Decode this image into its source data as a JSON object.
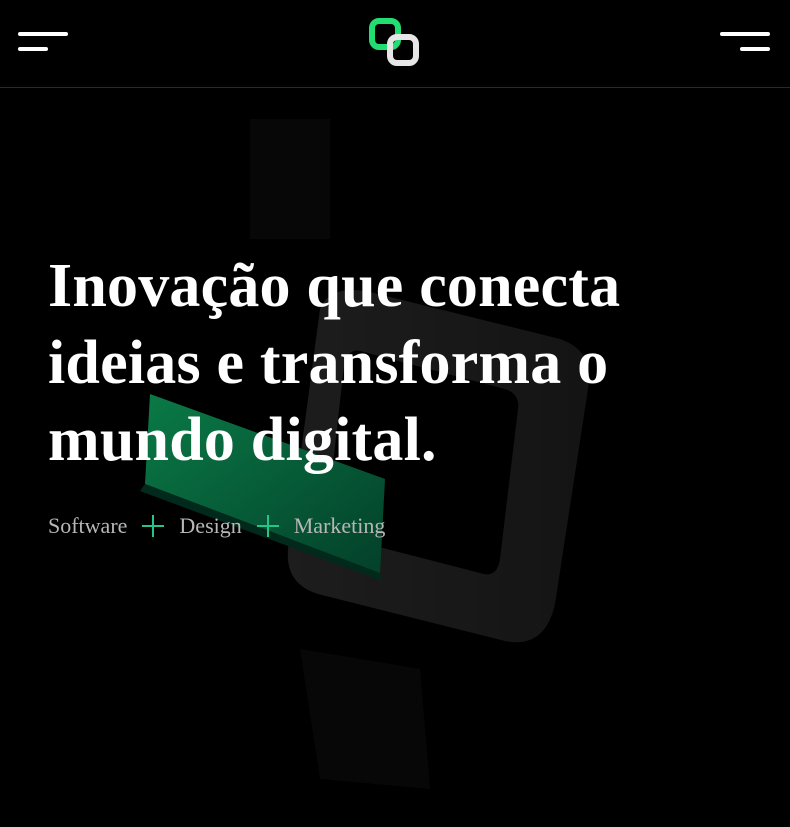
{
  "header": {
    "menu_left_icon": "menu-icon",
    "menu_right_icon": "menu-icon",
    "logo_icon": "linked-squares-logo",
    "colors": {
      "logo_green": "#22dd70",
      "logo_light": "#e6e6e6"
    }
  },
  "hero": {
    "headline": "Inovação que conecta ideias e transforma o mundo digital.",
    "services": [
      "Software",
      "Design",
      "Marketing"
    ],
    "separator_icon": "plus-icon",
    "colors": {
      "background": "#000000",
      "accent": "#27c48a",
      "service_text": "#b7b7b7"
    }
  }
}
